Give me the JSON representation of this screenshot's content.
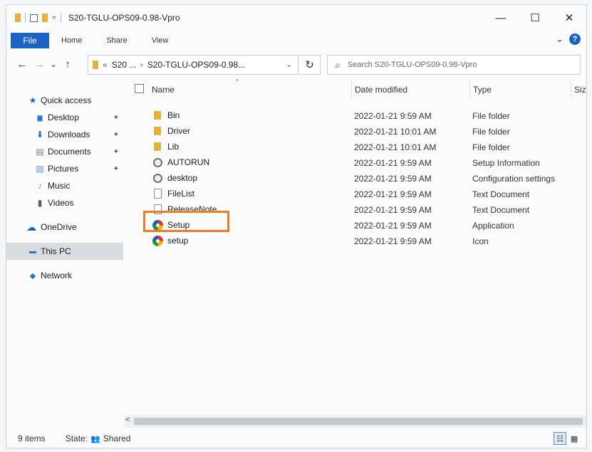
{
  "window": {
    "title": "S20-TGLU-OPS09-0.98-Vpro",
    "minimize_glyph": "—",
    "maximize_glyph": "☐",
    "close_glyph": "✕"
  },
  "ribbon": {
    "tabs": [
      "File",
      "Home",
      "Share",
      "View"
    ],
    "expand_glyph": "⌄",
    "help_glyph": "?"
  },
  "navbar": {
    "back_glyph": "←",
    "forward_glyph": "→",
    "recent_glyph": "⌄",
    "up_glyph": "↑",
    "breadcrumb_overflow": "«",
    "breadcrumb_parent": "S20 ...",
    "breadcrumb_current": "S20-TGLU-OPS09-0.98...",
    "address_dropdown_glyph": "⌄",
    "refresh_glyph": "↻",
    "search_glyph": "⌕",
    "search_placeholder": "Search S20-TGLU-OPS09-0.98-Vpro"
  },
  "sidebar": {
    "items": [
      {
        "label": "Quick access",
        "icon": "star-icon",
        "glyph": "★",
        "color": "#1a63c2",
        "pinned": false
      },
      {
        "label": "Desktop",
        "icon": "desktop-folder-icon",
        "glyph": "▆",
        "color": "#2a74c9",
        "pinned": true
      },
      {
        "label": "Downloads",
        "icon": "downloads-folder-icon",
        "glyph": "⬇",
        "color": "#1a63c2",
        "pinned": true
      },
      {
        "label": "Documents",
        "icon": "documents-folder-icon",
        "glyph": "▤",
        "color": "#7a8088",
        "pinned": true
      },
      {
        "label": "Pictures",
        "icon": "pictures-folder-icon",
        "glyph": "▨",
        "color": "#5e92cf",
        "pinned": true
      },
      {
        "label": "Music",
        "icon": "music-folder-icon",
        "glyph": "♪",
        "color": "#d08a2a",
        "pinned": false
      },
      {
        "label": "Videos",
        "icon": "videos-folder-icon",
        "glyph": "▮",
        "color": "#5a5f66",
        "pinned": false
      },
      {
        "label": "OneDrive",
        "icon": "cloud-icon",
        "glyph": "☁",
        "color": "#1a63c2",
        "pinned": false
      },
      {
        "label": "This PC",
        "icon": "computer-icon",
        "glyph": "▬",
        "color": "#2a74c9",
        "pinned": false,
        "selected": true
      },
      {
        "label": "Network",
        "icon": "network-icon",
        "glyph": "◆",
        "color": "#2a74c9",
        "pinned": false
      }
    ],
    "pin_glyph": "✦"
  },
  "columns": {
    "name": "Name",
    "date": "Date modified",
    "type": "Type",
    "size": "Siz",
    "sort_glyph": "^"
  },
  "files": [
    {
      "name": "Bin",
      "date": "2022-01-21 9:59 AM",
      "type": "File folder",
      "icon": "folder-icon"
    },
    {
      "name": "Driver",
      "date": "2022-01-21 10:01 AM",
      "type": "File folder",
      "icon": "folder-icon"
    },
    {
      "name": "Lib",
      "date": "2022-01-21 10:01 AM",
      "type": "File folder",
      "icon": "folder-icon"
    },
    {
      "name": "AUTORUN",
      "date": "2022-01-21 9:59 AM",
      "type": "Setup Information",
      "icon": "settings-file-icon"
    },
    {
      "name": "desktop",
      "date": "2022-01-21 9:59 AM",
      "type": "Configuration settings",
      "icon": "settings-file-icon"
    },
    {
      "name": "FileList",
      "date": "2022-01-21 9:59 AM",
      "type": "Text Document",
      "icon": "text-document-icon"
    },
    {
      "name": "ReleaseNote",
      "date": "2022-01-21 9:59 AM",
      "type": "Text Document",
      "icon": "text-document-icon"
    },
    {
      "name": "Setup",
      "date": "2022-01-21 9:59 AM",
      "type": "Application",
      "icon": "setup-disc-icon",
      "highlighted": true
    },
    {
      "name": "setup",
      "date": "2022-01-21 9:59 AM",
      "type": "Icon",
      "icon": "setup-disc-icon"
    }
  ],
  "status": {
    "item_count": "9 items",
    "state_label": "State:",
    "state_icon_glyph": "👥",
    "state_value": "Shared"
  },
  "scroll": {
    "left_glyph": "<"
  },
  "views": {
    "details_glyph": "☷",
    "tiles_glyph": "▦"
  },
  "colors": {
    "accent": "#1a63c2",
    "highlight_box": "#f07b22",
    "folder": "#e2b33c"
  }
}
